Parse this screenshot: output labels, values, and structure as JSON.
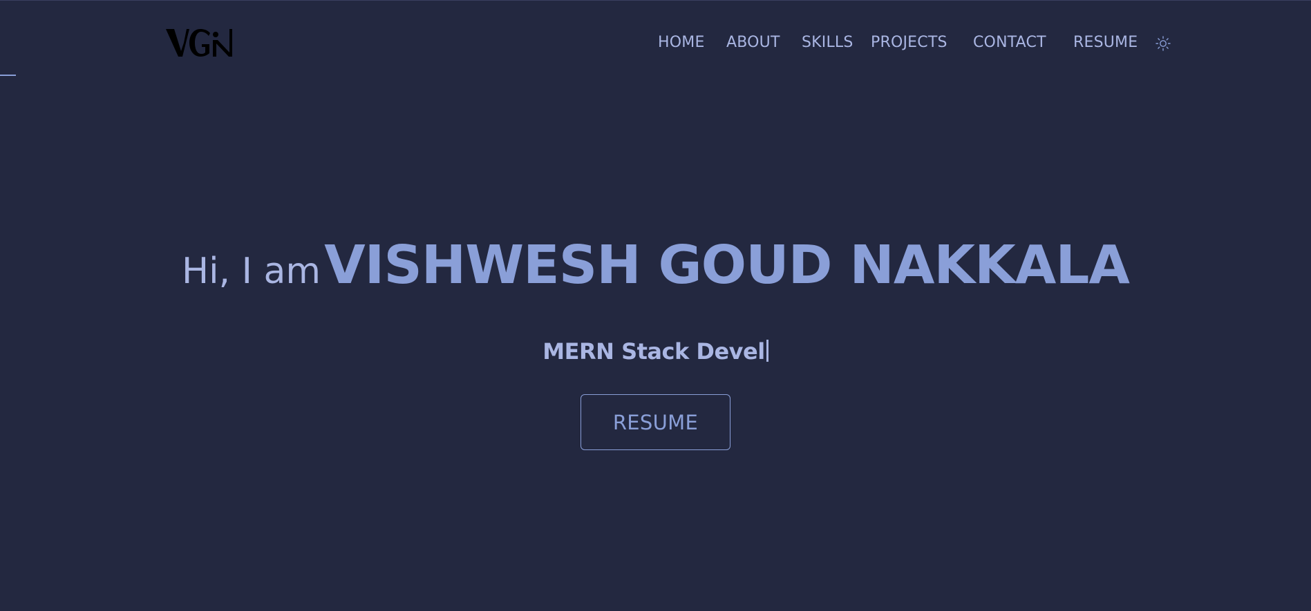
{
  "nav": {
    "logo_text": "VGN",
    "links": [
      "HOME",
      "ABOUT",
      "SKILLS",
      "PROJECTS",
      "CONTACT",
      "RESUME"
    ],
    "theme_toggle_icon": "sun-icon"
  },
  "hero": {
    "greeting": "Hi, I am",
    "name": "VISHWESH GOUD NAKKALA",
    "role": "MERN Stack Devel",
    "resume_button": "RESUME"
  },
  "colors": {
    "background": "#232840",
    "accent": "#8a9fd8",
    "text": "#aab6e3",
    "logo": "#000000"
  }
}
